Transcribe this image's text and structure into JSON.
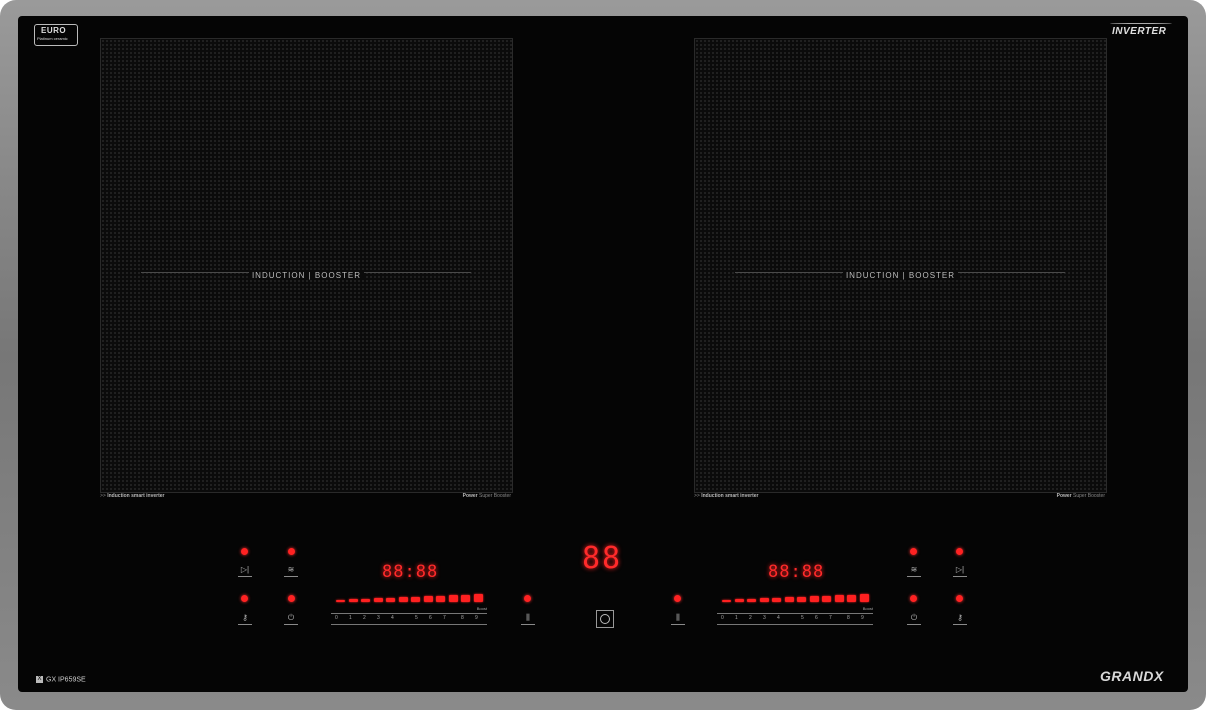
{
  "badge": {
    "line1": "EURO",
    "line2": "Platinum ceramic"
  },
  "logo_inverter": "INVERTER",
  "zones": [
    {
      "label": "INDUCTION | BOOSTER",
      "foot_left": ">> ",
      "foot_left_bold": "Induction smart inverter",
      "foot_right_bold": "Power",
      "foot_right": " Super Booster"
    },
    {
      "label": "INDUCTION | BOOSTER",
      "foot_left": ">> ",
      "foot_left_bold": "Induction smart inverter",
      "foot_right_bold": "Power",
      "foot_right": " Super Booster"
    }
  ],
  "controls": {
    "left_timer": "88:88",
    "right_timer": "88:88",
    "center_display": "88",
    "scale_numbers": [
      "0",
      "1",
      "2",
      "3",
      "4",
      "5",
      "6",
      "7",
      "8",
      "9"
    ],
    "boost_label": "Boost",
    "left_power_level": 1.0,
    "right_power_level": 1.0,
    "indicator_color": "#ff2020"
  },
  "model": {
    "icon": "X",
    "text": "GX IP659SE"
  },
  "brand": "GRANDX"
}
